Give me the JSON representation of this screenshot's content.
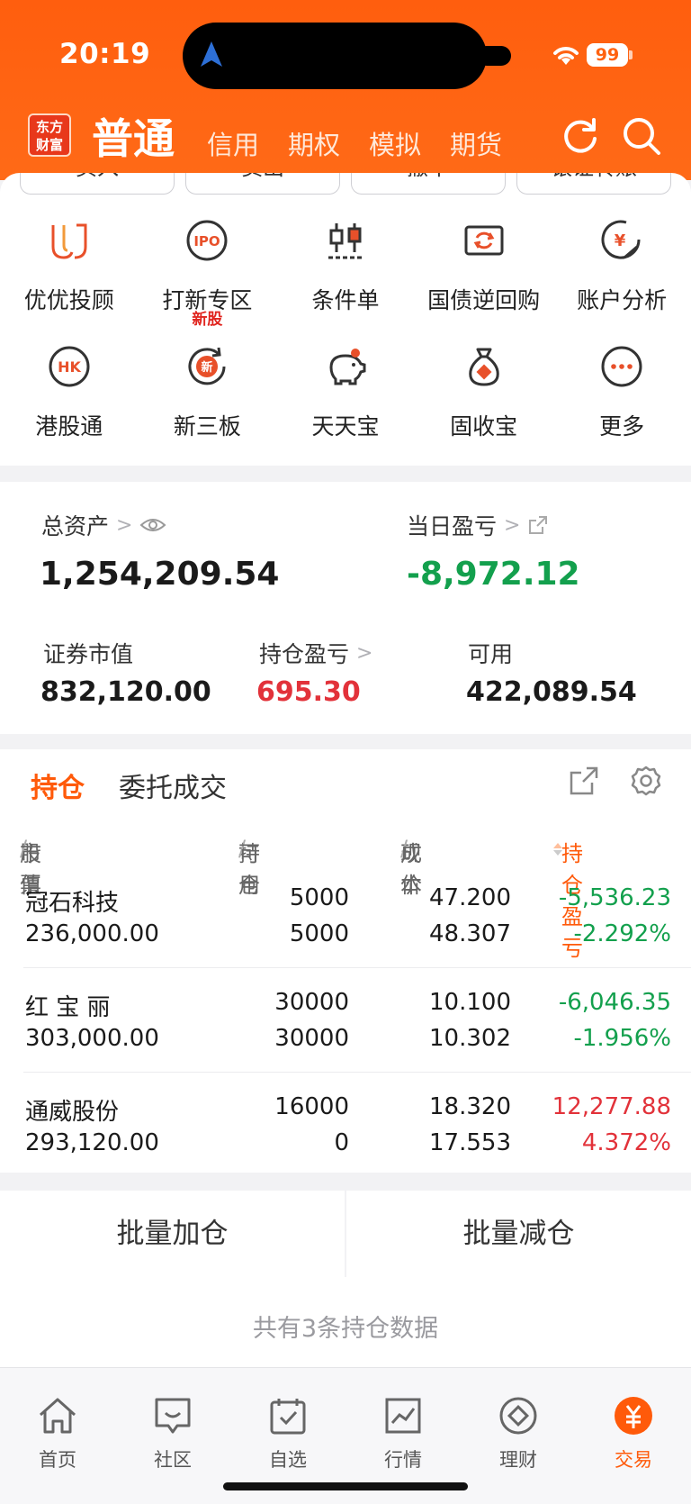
{
  "status_bar": {
    "time": "20:19",
    "battery": "99"
  },
  "header": {
    "logo_text": "东方财富",
    "active_tab": "普通",
    "tabs": [
      "信用",
      "期权",
      "模拟",
      "期货"
    ]
  },
  "quick_actions": [
    "买入",
    "卖出",
    "撤单",
    "银证转账"
  ],
  "grid": [
    {
      "label": "优优投顾",
      "icon": "uu-advisor-icon"
    },
    {
      "label": "打新专区",
      "icon": "ipo-icon",
      "tag": "新股"
    },
    {
      "label": "条件单",
      "icon": "candlestick-icon"
    },
    {
      "label": "国债逆回购",
      "icon": "repo-icon"
    },
    {
      "label": "账户分析",
      "icon": "yuan-chart-icon"
    },
    {
      "label": "港股通",
      "icon": "hk-icon"
    },
    {
      "label": "新三板",
      "icon": "new-board-icon"
    },
    {
      "label": "天天宝",
      "icon": "piggy-bank-icon"
    },
    {
      "label": "固收宝",
      "icon": "money-bag-icon"
    },
    {
      "label": "更多",
      "icon": "more-icon"
    }
  ],
  "assets": {
    "total_label": "总资产",
    "total_value": "1,254,209.54",
    "daily_pl_label": "当日盈亏",
    "daily_pl_value": "-8,972.12",
    "market_value_label": "证券市值",
    "market_value": "832,120.00",
    "position_pl_label": "持仓盈亏",
    "position_pl_value": "695.30",
    "available_label": "可用",
    "available_value": "422,089.54"
  },
  "holdings": {
    "tab_active": "持仓",
    "tab_inactive": "委托成交",
    "headers": {
      "stock": "股票",
      "market_value": "市值",
      "position": "持仓",
      "available": "可用",
      "price": "现价",
      "cost": "成本",
      "pl": "持仓盈亏"
    },
    "rows": [
      {
        "name": "冠石科技",
        "value": "236,000.00",
        "position": "5000",
        "available": "5000",
        "price": "47.200",
        "cost": "48.307",
        "pl": "-5,536.23",
        "pl_pct": "-2.292%",
        "trend": "down"
      },
      {
        "name": "红 宝 丽",
        "value": "303,000.00",
        "position": "30000",
        "available": "30000",
        "price": "10.100",
        "cost": "10.302",
        "pl": "-6,046.35",
        "pl_pct": "-1.956%",
        "trend": "down"
      },
      {
        "name": "通威股份",
        "value": "293,120.00",
        "position": "16000",
        "available": "0",
        "price": "18.320",
        "cost": "17.553",
        "pl": "12,277.88",
        "pl_pct": "4.372%",
        "trend": "up"
      }
    ]
  },
  "batch": {
    "add": "批量加仓",
    "reduce": "批量减仓"
  },
  "summary": "共有3条持仓数据",
  "bottom_nav": [
    {
      "label": "首页",
      "icon": "home-icon"
    },
    {
      "label": "社区",
      "icon": "community-icon"
    },
    {
      "label": "自选",
      "icon": "watchlist-icon"
    },
    {
      "label": "行情",
      "icon": "market-icon"
    },
    {
      "label": "理财",
      "icon": "wealth-icon"
    },
    {
      "label": "交易",
      "icon": "trade-icon",
      "active": true
    }
  ],
  "colors": {
    "brand": "#ff5e0e",
    "up": "#e2323a",
    "down": "#13a04d"
  }
}
